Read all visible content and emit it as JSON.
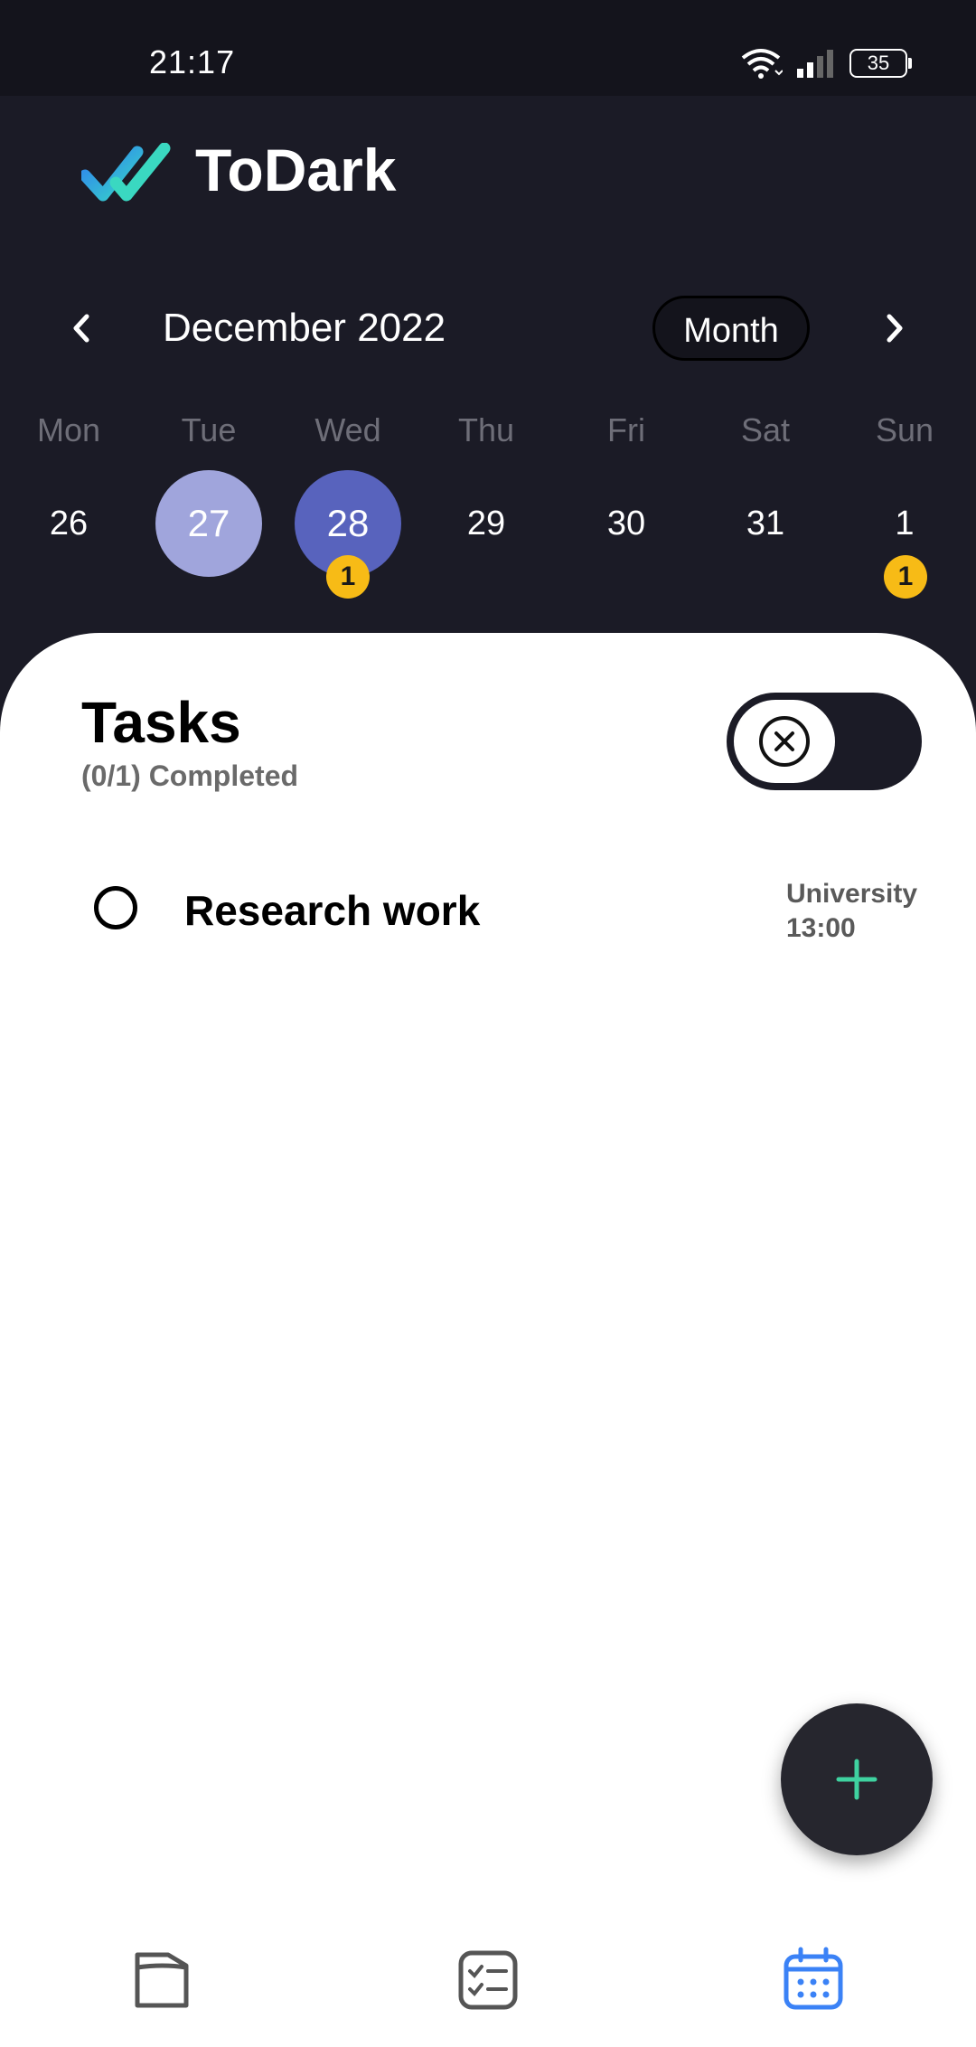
{
  "status_bar": {
    "time": "21:17",
    "battery": "35"
  },
  "header": {
    "app_title": "ToDark"
  },
  "calendar": {
    "month_label": "December 2022",
    "view_toggle": "Month",
    "weekdays": [
      "Mon",
      "Tue",
      "Wed",
      "Thu",
      "Fri",
      "Sat",
      "Sun"
    ],
    "days": [
      {
        "num": "26"
      },
      {
        "num": "27",
        "state": "selected"
      },
      {
        "num": "28",
        "state": "today",
        "badge": "1"
      },
      {
        "num": "29"
      },
      {
        "num": "30"
      },
      {
        "num": "31"
      },
      {
        "num": "1",
        "badge": "1"
      }
    ]
  },
  "tasks": {
    "title": "Tasks",
    "completed": "(0/1) Completed",
    "items": [
      {
        "title": "Research work",
        "category": "University",
        "time": "13:00"
      }
    ]
  },
  "colors": {
    "accent": "#5863bd",
    "selected": "#a0a5dc",
    "badge": "#f7bb16",
    "fab_plus": "#3fd2a0",
    "nav_active": "#3b82f6"
  },
  "icons": {
    "logo": "double-check-logo",
    "toggle": "close-circle-icon",
    "fab": "plus-icon",
    "nav": [
      "folder-icon",
      "checklist-icon",
      "calendar-icon"
    ]
  }
}
